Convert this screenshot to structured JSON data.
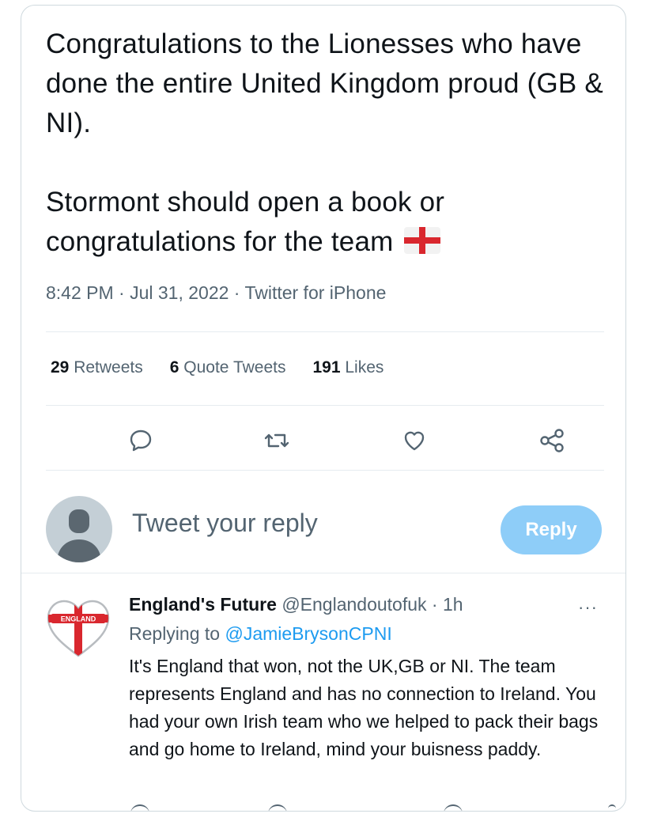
{
  "tweet": {
    "text_paragraph_1": "Congratulations to the Lionesses who have done the entire United Kingdom proud (GB & NI).",
    "text_paragraph_2": "Stormont should open a book or congratulations for the team",
    "flag_icon": "england-flag-icon",
    "timestamp": "8:42 PM · Jul 31, 2022 · Twitter for iPhone",
    "stats": {
      "retweets_count": "29",
      "retweets_label": "Retweets",
      "quotes_count": "6",
      "quotes_label": "Quote Tweets",
      "likes_count": "191",
      "likes_label": "Likes"
    },
    "actions": [
      "reply-icon",
      "retweet-icon",
      "like-icon",
      "share-icon"
    ]
  },
  "reply_composer": {
    "placeholder": "Tweet your reply",
    "button_label": "Reply",
    "button_color": "#8ecdf8"
  },
  "reply_tweet": {
    "display_name": "England's Future",
    "handle": "@Englandoutofuk",
    "time": "· 1h",
    "more_label": "···",
    "replying_prefix": "Replying to",
    "replying_handle": "@JamieBrysonCPNI",
    "avatar_text": "ENGLAND",
    "body": "It's England that won, not the UK,GB or NI. The team represents England and has no connection to Ireland. You had your own Irish team who we helped to pack their bags and go home to Ireland, mind your buisness paddy."
  },
  "colors": {
    "text": "#0f1419",
    "secondary": "#536471",
    "link": "#1d9bf0",
    "border": "#cfd9de"
  }
}
